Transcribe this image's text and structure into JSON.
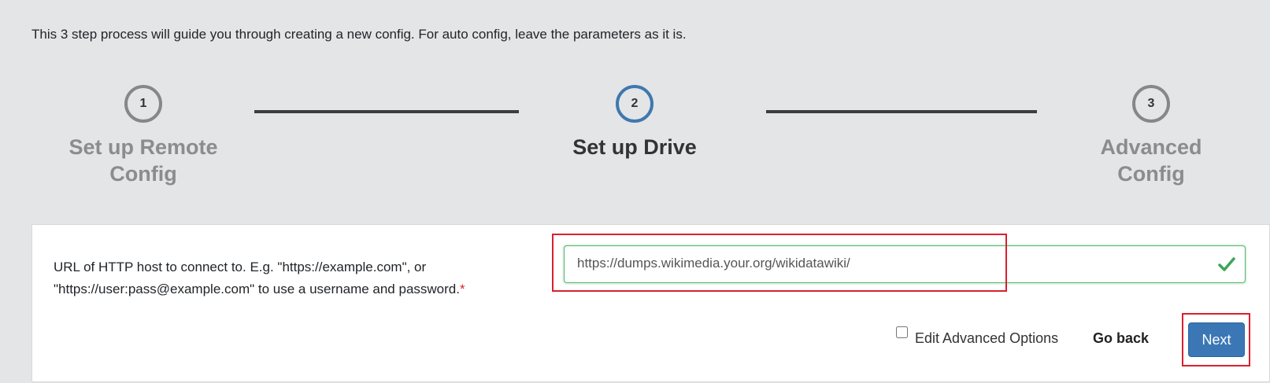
{
  "intro": "This 3 step process will guide you through creating a new config. For auto config, leave the parameters as it is.",
  "steps": [
    {
      "number": "1",
      "title_line1": "Set up Remote",
      "title_line2": "Config",
      "state": "inactive"
    },
    {
      "number": "2",
      "title_line1": "Set up Drive",
      "title_line2": "",
      "state": "active"
    },
    {
      "number": "3",
      "title_line1": "Advanced",
      "title_line2": "Config",
      "state": "inactive"
    }
  ],
  "form": {
    "url_label": "URL of HTTP host to connect to. E.g. \"https://example.com\", or \"https://user:pass@example.com\" to use a username and password.",
    "required_mark": "*",
    "url_value": "https://dumps.wikimedia.your.org/wikidatawiki/",
    "validation": "valid"
  },
  "actions": {
    "advanced_label": "Edit Advanced Options",
    "advanced_checked": false,
    "go_back_label": "Go back",
    "next_label": "Next"
  },
  "colors": {
    "active_step": "#3f78ae",
    "inactive_step": "#878787",
    "valid_green": "#4fb56a",
    "primary_button": "#3b77b5",
    "highlight_red": "#d9202f"
  }
}
